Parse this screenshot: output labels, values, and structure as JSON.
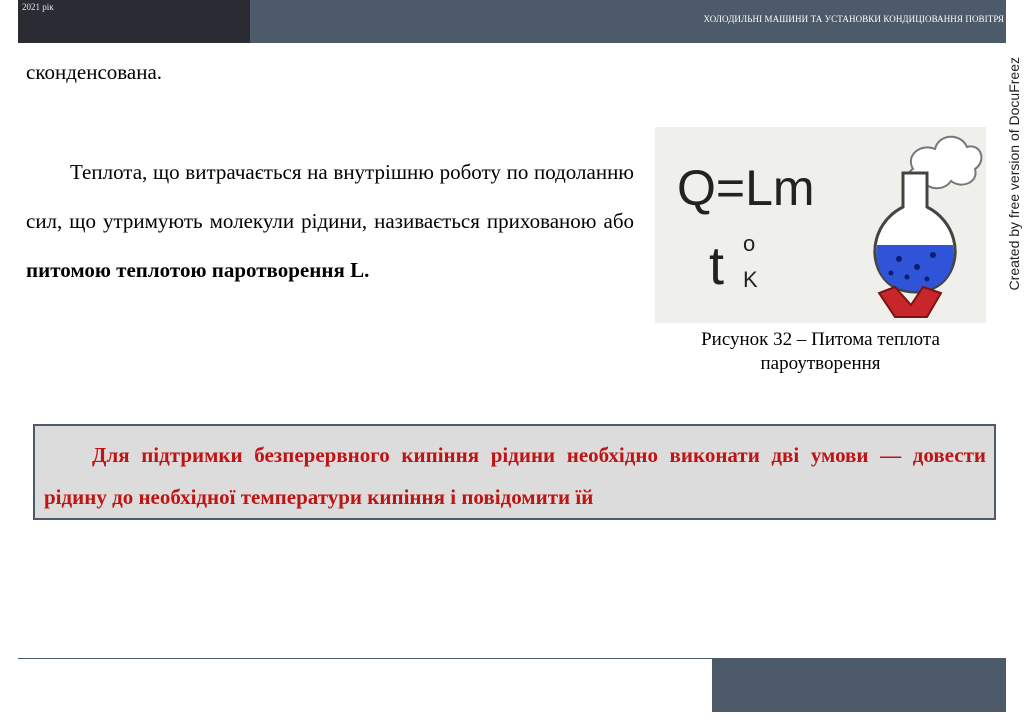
{
  "header": {
    "year": "2021 рік",
    "title": "ХОЛОДИЛЬНІ МАШИНИ ТА УСТАНОВКИ КОНДИЦІОВАННЯ ПОВІТРЯ"
  },
  "watermark": "Created by free version of DocuFreez",
  "body": {
    "fragment": "сконденсована.",
    "paragraph_normal": "Теплота, що витрачається на внутрішню роботу по подоланню сил, що утримують молекули рідини, називається прихованою або ",
    "paragraph_bold": "питомою теплотою паротворення L."
  },
  "figure": {
    "formula_q": "Q=Lm",
    "formula_t": "t",
    "formula_t_sup": "o",
    "formula_t_sub": "K",
    "caption_line1": "Рисунок 32 – Питома теплота",
    "caption_line2": "пароутворення"
  },
  "callout": {
    "text": "Для підтримки безперервного кипіння рідини необхідно виконати дві умови — довести рідину до необхідної температури кипіння і повідомити їй"
  },
  "colors": {
    "header_bar": "#4d5a69",
    "header_dark": "#2b2b33",
    "callout_text": "#c01414",
    "callout_bg": "#dcdcdc",
    "liquid": "#2f54d8",
    "flame": "#c8262b"
  }
}
